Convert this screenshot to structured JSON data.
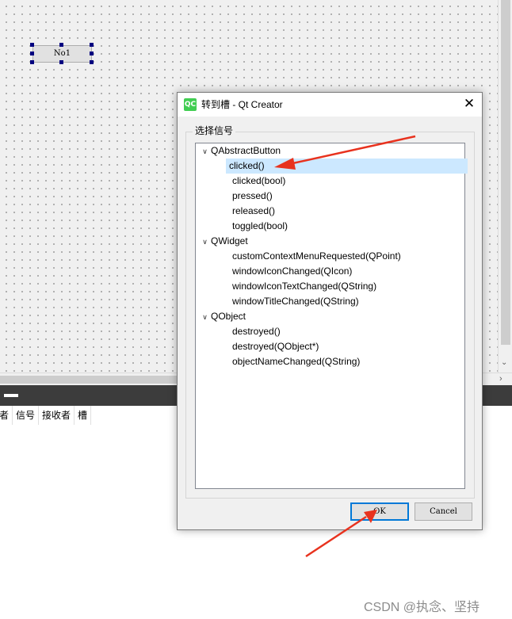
{
  "canvas": {
    "widget_label": "No1"
  },
  "signal_slot_editor": {
    "columns": [
      "者",
      "信号",
      "接收者",
      "槽"
    ]
  },
  "dialog": {
    "title": "转到槽 - Qt Creator",
    "logo_text": "QC",
    "close_glyph": "✕",
    "group_title": "选择信号",
    "tree": [
      {
        "category": "QAbstractButton",
        "signals": [
          "clicked()",
          "clicked(bool)",
          "pressed()",
          "released()",
          "toggled(bool)"
        ]
      },
      {
        "category": "QWidget",
        "signals": [
          "customContextMenuRequested(QPoint)",
          "windowIconChanged(QIcon)",
          "windowIconTextChanged(QString)",
          "windowTitleChanged(QString)"
        ]
      },
      {
        "category": "QObject",
        "signals": [
          "destroyed()",
          "destroyed(QObject*)",
          "objectNameChanged(QString)"
        ]
      }
    ],
    "selected_signal": "clicked()",
    "ok_label": "OK",
    "cancel_label": "Cancel"
  },
  "annotation_color": "#e8321e",
  "watermark": "CSDN @执念、坚持"
}
